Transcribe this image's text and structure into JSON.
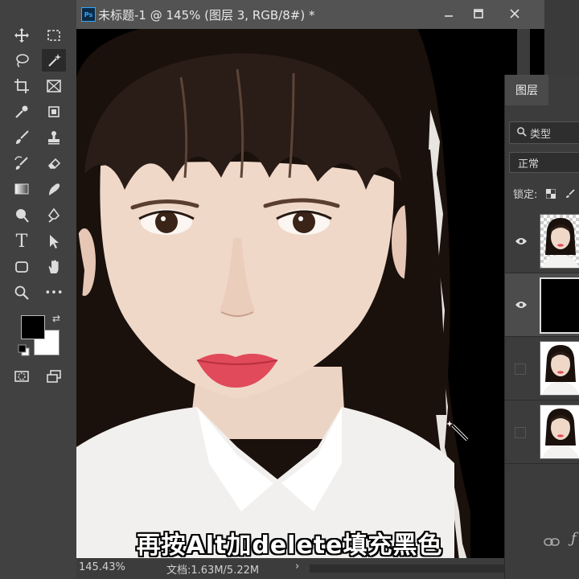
{
  "document": {
    "title": "未标题-1 @ 145% (图层 3, RGB/8#) *",
    "app_badge": "Ps",
    "window_controls": [
      "minimize",
      "maximize",
      "close"
    ]
  },
  "status": {
    "zoom": "145.43%",
    "doc_size": "文档:1.63M/5.22M",
    "arrow": "›"
  },
  "toolbar": {
    "tools": [
      "move-icon",
      "marquee-icon",
      "lasso-icon",
      "magic-wand-icon",
      "crop-icon",
      "frame-icon",
      "eyedropper-icon",
      "healing-icon",
      "brush-icon",
      "stamp-icon",
      "history-brush-icon",
      "eraser-icon",
      "gradient-icon",
      "smudge-icon",
      "dodge-icon",
      "pen-icon",
      "text-icon",
      "path-select-icon",
      "shape-icon",
      "hand-icon",
      "zoom-icon",
      "more-icon"
    ],
    "text_tool_label": "T",
    "more_label": "•••",
    "foreground_color": "#000000",
    "background_color": "#ffffff"
  },
  "layers_panel": {
    "tab_label": "图层",
    "filter_label": "类型",
    "blend_mode": "正常",
    "lock_label": "锁定:",
    "footer_label": "ƒ",
    "layers": [
      {
        "visible": true,
        "thumb": "portrait-transparent"
      },
      {
        "visible": true,
        "thumb": "black-fill",
        "selected": true
      },
      {
        "visible": false,
        "thumb": "portrait"
      },
      {
        "visible": false,
        "thumb": "portrait"
      }
    ]
  },
  "caption": "再按Alt加delete填充黑色",
  "colors": {
    "accent": "#31a8ff",
    "canvas_fill": "#000000",
    "lip": "#e04a5a"
  }
}
